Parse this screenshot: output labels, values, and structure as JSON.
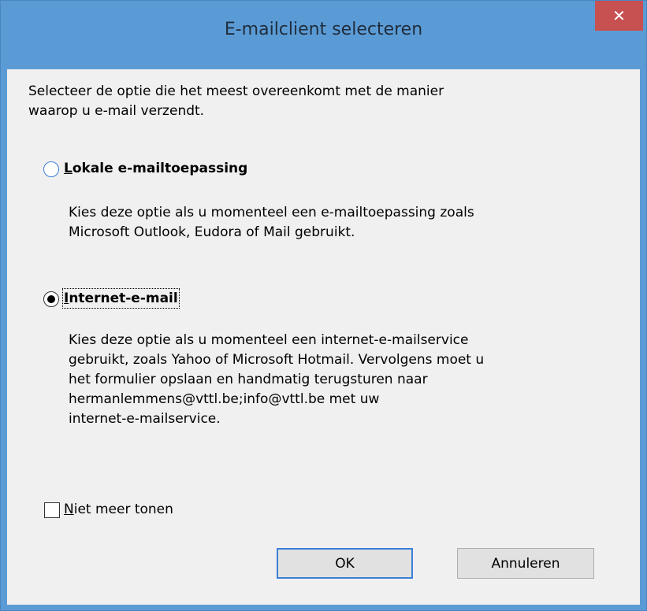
{
  "window": {
    "title": "E-mailclient selecteren",
    "close_symbol": "✕"
  },
  "intro_lines": [
    "Selecteer de optie die het meest overeenkomt met de manier",
    "waarop u e-mail verzendt."
  ],
  "options": [
    {
      "mnemonic": "L",
      "label_rest": "okale e-mailtoepassing",
      "selected": false,
      "description_lines": [
        "Kies deze optie als u momenteel een e-mailtoepassing zoals",
        "Microsoft Outlook, Eudora of Mail gebruikt."
      ]
    },
    {
      "mnemonic": "I",
      "label_rest": "nternet-e-mail",
      "selected": true,
      "description_lines": [
        "Kies deze optie als u momenteel een internet-e-mailservice",
        "gebruikt, zoals Yahoo of Microsoft Hotmail. Vervolgens moet u",
        "het formulier opslaan en handmatig terugsturen naar",
        "hermanlemmens@vttl.be;info@vttl.be met uw",
        "internet-e-mailservice."
      ]
    }
  ],
  "checkbox": {
    "mnemonic": "N",
    "label_rest": "iet meer tonen",
    "checked": false
  },
  "buttons": {
    "ok": "OK",
    "cancel": "Annuleren"
  },
  "colors": {
    "titlebar": "#5b9bd5",
    "close_button": "#c75050",
    "client_background": "#f0f0f0",
    "focus_border": "#3c7fd8"
  }
}
